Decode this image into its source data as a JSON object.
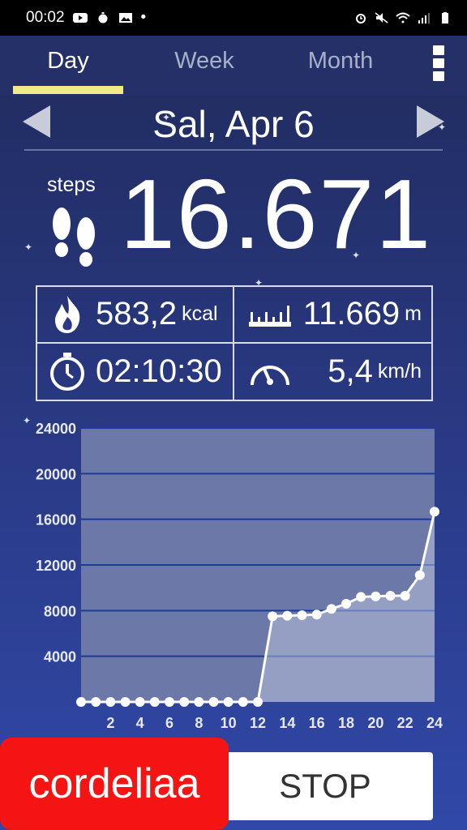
{
  "status_bar": {
    "time": "00:02",
    "dot": "•"
  },
  "tabs": [
    {
      "label": "Day",
      "active": true
    },
    {
      "label": "Week",
      "active": false
    },
    {
      "label": "Month",
      "active": false
    }
  ],
  "date": {
    "label": "Sal, Apr 6"
  },
  "steps": {
    "label": "steps",
    "value": "16.671"
  },
  "stats": {
    "calories": {
      "value": "583,2",
      "unit": "kcal"
    },
    "distance": {
      "value": "11.669",
      "unit": "m"
    },
    "duration": {
      "value": "02:10:30"
    },
    "speed": {
      "value": "5,4",
      "unit": "km/h"
    }
  },
  "stop_button": {
    "label": "STOP"
  },
  "watermark": {
    "text": "cordeliaa"
  },
  "colors": {
    "accent_tab": "#f5e88a",
    "chart_fill": "#c8cfe6",
    "chart_line": "#ffffff",
    "grid": "#1d3a9a"
  },
  "chart_data": {
    "type": "line",
    "x": [
      0,
      1,
      2,
      3,
      4,
      5,
      6,
      7,
      8,
      9,
      10,
      11,
      12,
      13,
      14,
      15,
      16,
      17,
      18,
      19,
      20,
      21,
      22,
      23,
      24
    ],
    "values": [
      0,
      0,
      0,
      0,
      0,
      0,
      0,
      0,
      0,
      0,
      0,
      0,
      0,
      7500,
      7550,
      7600,
      7650,
      8150,
      8600,
      9200,
      9250,
      9300,
      9300,
      11100,
      16671
    ],
    "ylim": [
      0,
      24000
    ],
    "y_ticks": [
      4000,
      8000,
      12000,
      16000,
      20000,
      24000
    ],
    "x_ticks": [
      2,
      4,
      6,
      8,
      10,
      12,
      14,
      16,
      18,
      20,
      22,
      24
    ],
    "grid": true
  }
}
